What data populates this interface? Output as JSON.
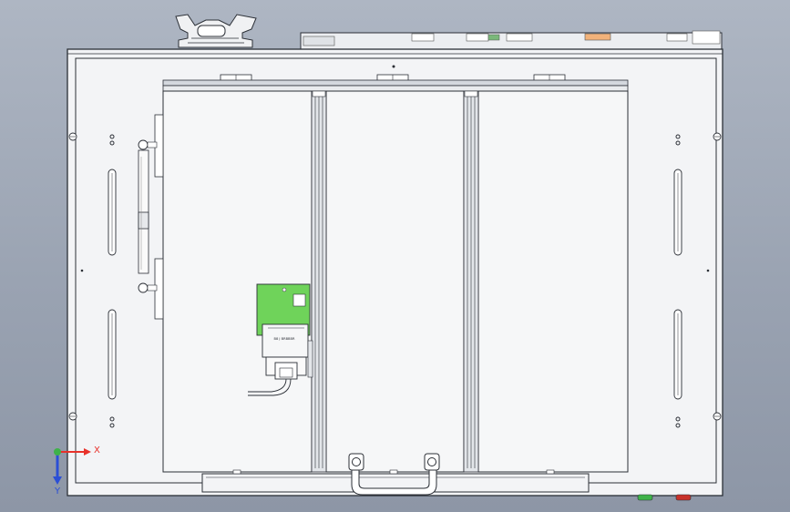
{
  "triad": {
    "x_label": "X",
    "y_label": "Y"
  },
  "pcb_marking": "B8 J BRBBBR",
  "colors": {
    "background_top": "#aeb6c3",
    "background_bottom": "#8d96a6",
    "enclosure": "#f3f4f6",
    "outline": "#2b2f36",
    "pcb_board": "#6fd35a",
    "axis_x": "#e8312a",
    "axis_y": "#2b4fd6",
    "axis_z": "#3fb24a",
    "indicator_green": "#3fb24a",
    "indicator_red": "#c8322a",
    "connector_orange": "#f2b27a"
  }
}
